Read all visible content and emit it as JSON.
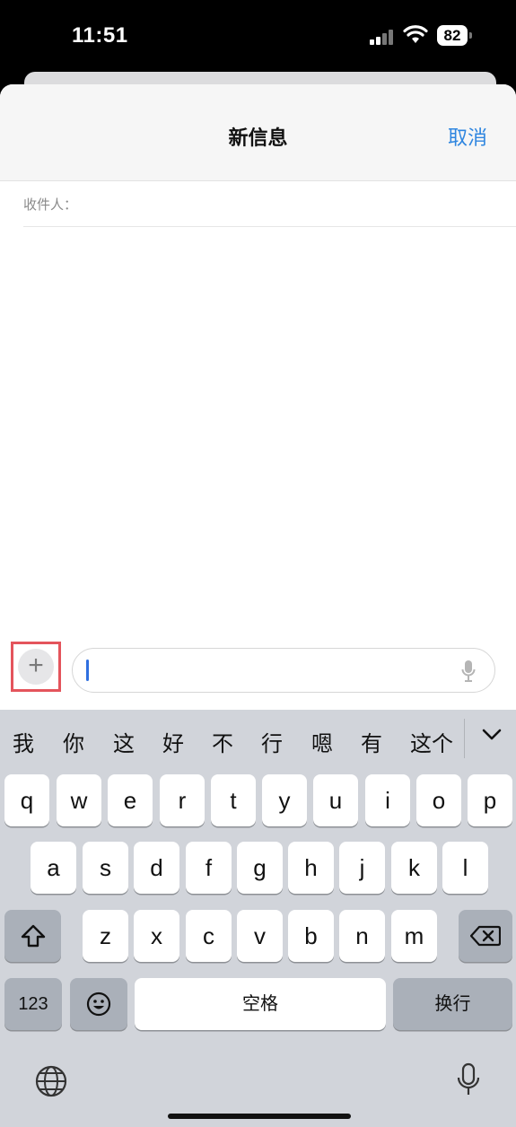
{
  "status_bar": {
    "time": "11:51",
    "battery": "82"
  },
  "nav": {
    "title": "新信息",
    "cancel": "取消"
  },
  "recipient": {
    "label": "收件人："
  },
  "composer": {
    "plus": "+",
    "placeholder": ""
  },
  "keyboard": {
    "candidates": [
      "我",
      "你",
      "这",
      "好",
      "不",
      "行",
      "嗯",
      "有",
      "这个"
    ],
    "row1": [
      "q",
      "w",
      "e",
      "r",
      "t",
      "y",
      "u",
      "i",
      "o",
      "p"
    ],
    "row2": [
      "a",
      "s",
      "d",
      "f",
      "g",
      "h",
      "j",
      "k",
      "l"
    ],
    "row3": [
      "z",
      "x",
      "c",
      "v",
      "b",
      "n",
      "m"
    ],
    "numbers": "123",
    "space": "空格",
    "return": "换行"
  },
  "icons": [
    "signal-icon",
    "wifi-icon",
    "battery-icon",
    "plus-icon",
    "microphone-icon",
    "chevron-down-icon",
    "shift-icon",
    "delete-icon",
    "emoji-icon",
    "globe-icon",
    "dictation-icon"
  ]
}
